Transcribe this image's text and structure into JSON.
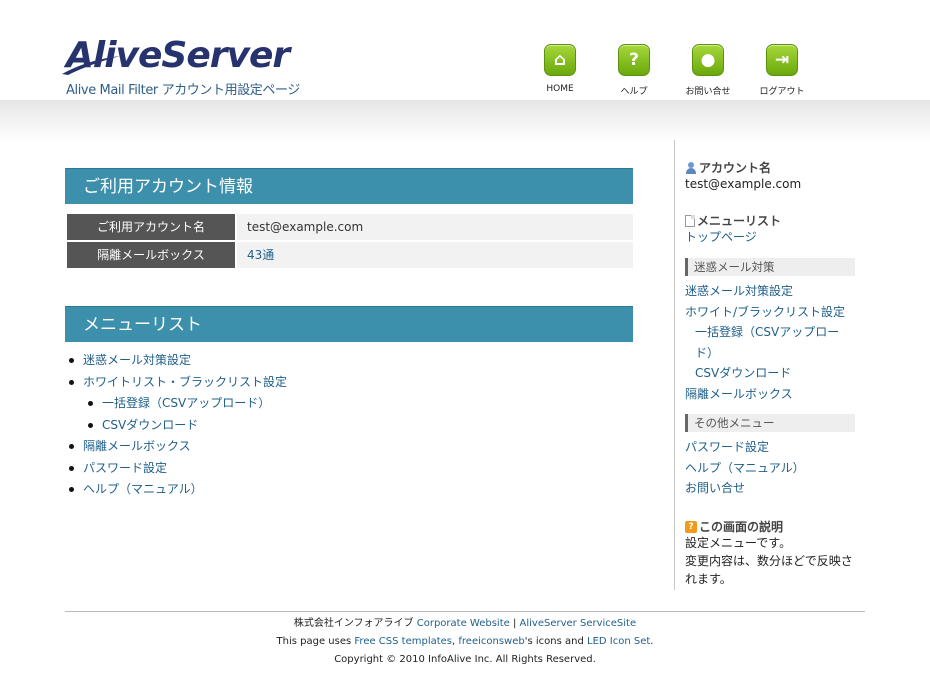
{
  "brand": {
    "logo_text": "AliveServer",
    "subtitle": "Alive Mail Filter アカウント用設定ページ"
  },
  "nav": [
    {
      "icon": "home-icon",
      "glyph": "⌂",
      "label": "HOME"
    },
    {
      "icon": "help-icon",
      "glyph": "?",
      "label": "ヘルプ"
    },
    {
      "icon": "contact-icon",
      "glyph": "●",
      "label": "お問い合せ"
    },
    {
      "icon": "logout-icon",
      "glyph": "⇥",
      "label": "ログアウト"
    }
  ],
  "account_section": {
    "title": "ご利用アカウント情報",
    "rows": [
      {
        "label": "ご利用アカウント名",
        "value": "test@example.com"
      },
      {
        "label": "隔離メールボックス",
        "value": "43通"
      }
    ]
  },
  "menu_section": {
    "title": "メニューリスト",
    "items": [
      {
        "label": "迷惑メール対策設定"
      },
      {
        "label": "ホワイトリスト・ブラックリスト設定"
      },
      {
        "label": "一括登録（CSVアップロード）"
      },
      {
        "label": "CSVダウンロード"
      },
      {
        "label": "隔離メールボックス"
      },
      {
        "label": "パスワード設定"
      },
      {
        "label": "ヘルプ（マニュアル）"
      }
    ]
  },
  "sidebar": {
    "account_heading": "アカウント名",
    "account_value": "test@example.com",
    "menu_heading": "メニューリスト",
    "top_link": "トップページ",
    "spam_group": "迷惑メール対策",
    "spam_links": [
      "迷惑メール対策設定",
      "ホワイト/ブラックリスト設定",
      "一括登録（CSVアップロード）",
      "CSVダウンロード",
      "隔離メールボックス"
    ],
    "other_group": "その他メニュー",
    "other_links": [
      "パスワード設定",
      "ヘルプ（マニュアル）",
      "お問い合せ"
    ],
    "explain_heading": "この画面の説明",
    "explain_text_1": "設定メニューです。",
    "explain_text_2": "変更内容は、数分ほどで反映されます。"
  },
  "footer": {
    "company": "株式会社インフォアライブ",
    "corporate_link": "Corporate Website",
    "sep": "|",
    "service_link": "AliveServer ServiceSite",
    "uses_prefix": "This page uses",
    "css_link": "Free CSS templates",
    "comma": ",",
    "icons_link": "freeiconsweb",
    "icons_suffix": "'s icons and",
    "led_link": "LED Icon Set",
    "period": ".",
    "copyright": "Copyright © 2010 InfoAlive Inc. All Rights Reserved."
  }
}
